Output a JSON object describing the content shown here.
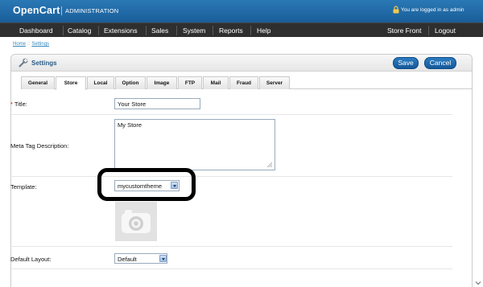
{
  "header": {
    "logo": "OpenCart",
    "subtitle": "ADMINISTRATION",
    "login_status": "You are logged in as admin"
  },
  "menu": {
    "left": [
      "Dashboard",
      "Catalog",
      "Extensions",
      "Sales",
      "System",
      "Reports",
      "Help"
    ],
    "right": [
      "Store Front",
      "Logout"
    ]
  },
  "breadcrumb": {
    "home": "Home",
    "separator": "::",
    "current": "Settings"
  },
  "box": {
    "title": "Settings",
    "buttons": {
      "save": "Save",
      "cancel": "Cancel"
    }
  },
  "tabs": [
    "General",
    "Store",
    "Local",
    "Option",
    "Image",
    "FTP",
    "Mail",
    "Fraud",
    "Server"
  ],
  "active_tab": "Store",
  "form": {
    "title": {
      "required_mark": "*",
      "label": "Title:",
      "value": "Your Store"
    },
    "meta": {
      "label": "Meta Tag Description:",
      "value": "My Store"
    },
    "template": {
      "label": "Template:",
      "selected": "mycustomtheme"
    },
    "layout": {
      "label": "Default Layout:",
      "selected": "Default"
    }
  },
  "colors": {
    "header_blue": "#1f6aa8",
    "menu_dark": "#2f2f2f",
    "button_blue": "#1f6aab",
    "title_blue": "#2a5c86",
    "required_red": "#ff0000"
  },
  "icons": [
    "lock-icon",
    "settings-wrench-icon",
    "camera-placeholder-icon",
    "select-arrow-icon",
    "resize-grip-icon",
    "scroll-down-icon"
  ]
}
